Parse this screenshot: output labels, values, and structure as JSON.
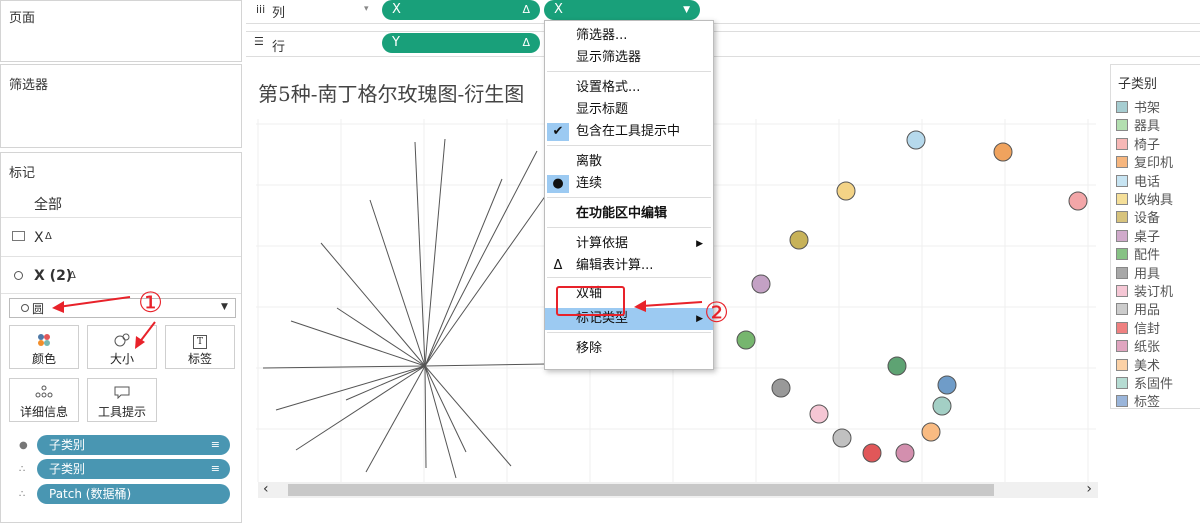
{
  "left": {
    "pages_title": "页面",
    "filters_title": "筛选器",
    "marks_title": "标记",
    "marks_all": "全部",
    "marks_x": "X",
    "marks_x2": "X (2)",
    "mark_type_selected": "圆",
    "buttons": {
      "color": "颜色",
      "size": "大小",
      "label": "标签",
      "detail": "详细信息",
      "tooltip": "工具提示"
    },
    "fields": [
      "子类别",
      "子类别",
      "Patch (数据桶)"
    ],
    "delta_glyph": "Δ"
  },
  "shelves": {
    "columns_label": "列",
    "rows_label": "行",
    "col_pill_1": "X",
    "col_pill_2": "X",
    "row_pill_1": "Y"
  },
  "chart": {
    "title": "第5种-南丁格尔玫瑰图-衍生图",
    "circle_colors": [
      "#b6d9ec",
      "#f0a35e",
      "#f3a6a8",
      "#f3d386",
      "#c7b259",
      "#c3a1c4",
      "#76b66e",
      "#999999",
      "#f5c6d4",
      "#c0c0c0",
      "#e15759",
      "#d38fae",
      "#f9bb82",
      "#a3cfc5",
      "#6f9cc8",
      "#5ea373"
    ],
    "legend_title": "子类别",
    "legend": [
      {
        "name": "书架",
        "color": "#a6cdd1"
      },
      {
        "name": "器具",
        "color": "#b3dfb0"
      },
      {
        "name": "椅子",
        "color": "#f7b8b6"
      },
      {
        "name": "复印机",
        "color": "#f6b67e"
      },
      {
        "name": "电话",
        "color": "#c7e4f2"
      },
      {
        "name": "收纳具",
        "color": "#f5df99"
      },
      {
        "name": "设备",
        "color": "#d7c37d"
      },
      {
        "name": "桌子",
        "color": "#d0aacb"
      },
      {
        "name": "配件",
        "color": "#87c285"
      },
      {
        "name": "用具",
        "color": "#a8a8a8"
      },
      {
        "name": "装订机",
        "color": "#f5c7d5"
      },
      {
        "name": "用品",
        "color": "#cccccc"
      },
      {
        "name": "信封",
        "color": "#ef8181"
      },
      {
        "name": "纸张",
        "color": "#e0a5c0"
      },
      {
        "name": "美术",
        "color": "#fbd1a6"
      },
      {
        "name": "系固件",
        "color": "#b6dcd3"
      },
      {
        "name": "标签",
        "color": "#9ab5da"
      }
    ]
  },
  "context_menu": {
    "items": [
      {
        "label": "筛选器...",
        "check": "",
        "submenu": false,
        "bold": false
      },
      {
        "label": "显示筛选器",
        "check": "",
        "submenu": false,
        "bold": false
      },
      {
        "label": "设置格式...",
        "check": "",
        "submenu": false,
        "bold": false
      },
      {
        "label": "显示标题",
        "check": "",
        "submenu": false,
        "bold": false
      },
      {
        "label": "包含在工具提示中",
        "check": "✔",
        "submenu": false,
        "bold": false
      },
      {
        "label": "离散",
        "check": "",
        "submenu": false,
        "bold": false
      },
      {
        "label": "连续",
        "check": "●",
        "submenu": false,
        "bold": false
      },
      {
        "label": "在功能区中编辑",
        "check": "",
        "submenu": false,
        "bold": true
      },
      {
        "label": "计算依据",
        "check": "",
        "submenu": true,
        "bold": false
      },
      {
        "label": "编辑表计算...",
        "check": "Δ",
        "submenu": false,
        "bold": false
      },
      {
        "label": "双轴",
        "check": "",
        "submenu": false,
        "bold": false
      },
      {
        "label": "标记类型",
        "check": "",
        "submenu": true,
        "bold": false
      },
      {
        "label": "移除",
        "check": "",
        "submenu": false,
        "bold": false
      }
    ],
    "highlighted_index": 11
  },
  "annotations": {
    "step1": "①",
    "step2": "②"
  },
  "scrollbar": {
    "left_arrow": "‹",
    "right_arrow": "›"
  }
}
